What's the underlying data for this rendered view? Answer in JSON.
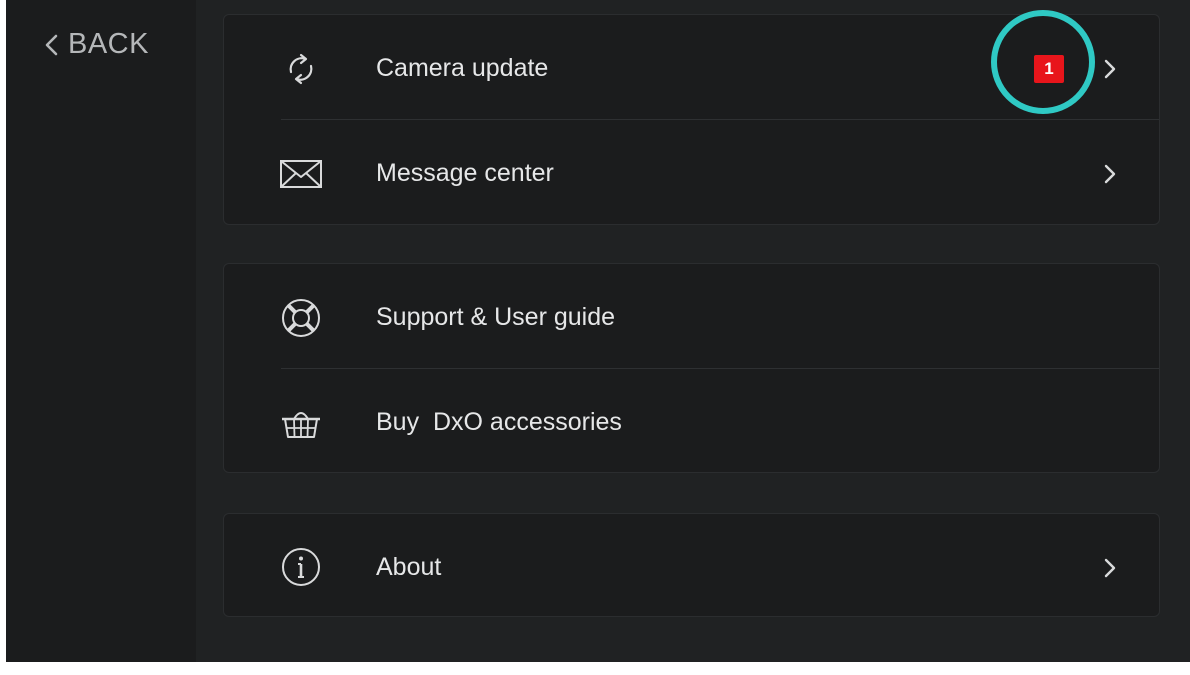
{
  "sidebar": {
    "back_label": "BACK"
  },
  "groups": [
    {
      "items": [
        {
          "label": "Camera update",
          "icon": "refresh-icon",
          "badge": "1",
          "has_chevron": true
        },
        {
          "label": "Message center",
          "icon": "envelope-icon",
          "has_chevron": true
        }
      ]
    },
    {
      "items": [
        {
          "label": "Support & User guide",
          "icon": "lifebuoy-icon",
          "has_chevron": false
        },
        {
          "label": "Buy  DxO accessories",
          "icon": "basket-icon",
          "has_chevron": false
        }
      ]
    },
    {
      "items": [
        {
          "label": "About",
          "icon": "info-icon",
          "has_chevron": true
        }
      ]
    }
  ],
  "colors": {
    "background": "#202223",
    "card": "#1b1c1d",
    "text": "#e6e7e8",
    "badge": "#e8151b",
    "highlight_ring": "#2fc9c4"
  }
}
